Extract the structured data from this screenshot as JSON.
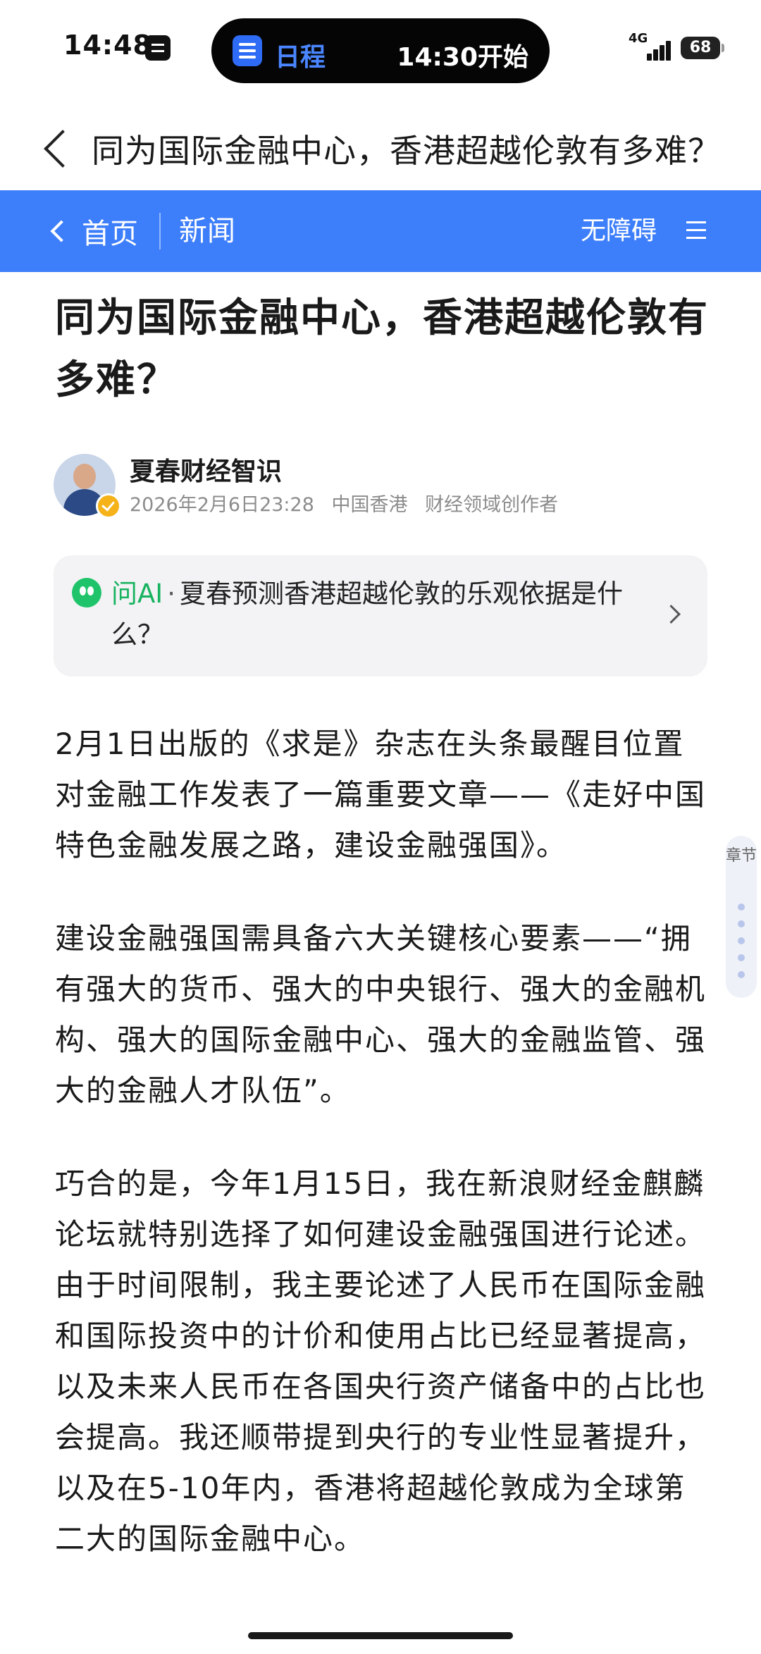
{
  "status_bar": {
    "time": "14:48",
    "island_label": "日程",
    "island_time": "14:30开始",
    "network": "4G",
    "battery": "68"
  },
  "header": {
    "title": "同为国际金融中心，香港超越伦敦有多难？"
  },
  "nav": {
    "home_label": "首页",
    "section_label": "新闻",
    "accessibility_label": "无障碍"
  },
  "article": {
    "title": "同为国际金融中心，香港超越伦敦有多难？",
    "author": {
      "name": "夏春财经智识",
      "datetime": "2026年2月6日23:28",
      "location": "中国香港",
      "role": "财经领域创作者"
    },
    "ai_card": {
      "label": "问AI",
      "separator": "·",
      "question": "夏春预测香港超越伦敦的乐观依据是什么？"
    },
    "paragraphs": [
      "2月1日出版的《求是》杂志在头条最醒目位置对金融工作发表了一篇重要文章——《走好中国特色金融发展之路，建设金融强国》。",
      "建设金融强国需具备六大关键核心要素——“拥有强大的货币、强大的中央银行、强大的金融机构、强大的国际金融中心、强大的金融监管、强大的金融人才队伍”。",
      "巧合的是，今年1月15日，我在新浪财经金麒麟论坛就特别选择了如何建设金融强国进行论述。由于时间限制，我主要论述了人民币在国际金融和国际投资中的计价和使用占比已经显著提高，以及未来人民币在各国央行资产储备中的占比也会提高。我还顺带提到央行的专业性显著提升，以及在5-10年内，香港将超越伦敦成为全球第二大的国际金融中心。"
    ]
  },
  "chapter_tab": {
    "label": "章节"
  },
  "colors": {
    "nav_bar": "#3d7efb",
    "ai_accent": "#17b35f",
    "island_accent": "#4a86ff"
  }
}
